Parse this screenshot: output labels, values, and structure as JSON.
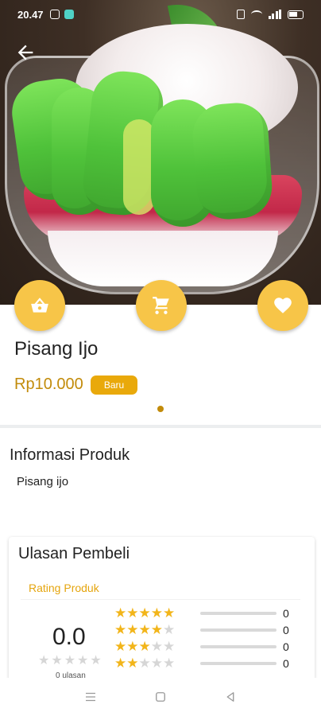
{
  "status_bar": {
    "time": "20.47"
  },
  "product": {
    "name": "Pisang Ijo",
    "price": "Rp10.000",
    "badge": "Baru"
  },
  "info": {
    "title": "Informasi Produk",
    "description": "Pisang ijo"
  },
  "reviews": {
    "title": "Ulasan Pembeli",
    "rating_label": "Rating Produk",
    "average": "0.0",
    "count_text": "0 ulasan",
    "breakdown": [
      {
        "stars": 5,
        "count": "0",
        "fraction": 0
      },
      {
        "stars": 4,
        "count": "0",
        "fraction": 0
      },
      {
        "stars": 3,
        "count": "0",
        "fraction": 0
      },
      {
        "stars": 2,
        "count": "0",
        "fraction": 0
      }
    ]
  },
  "colors": {
    "accent": "#f7c548",
    "price": "#c28b0a",
    "badge": "#e9a90b",
    "star": "#f2b51a"
  },
  "icons": {
    "back": "arrow-left-icon",
    "basket": "basket-icon",
    "cart": "cart-icon",
    "favorite": "heart-icon"
  }
}
